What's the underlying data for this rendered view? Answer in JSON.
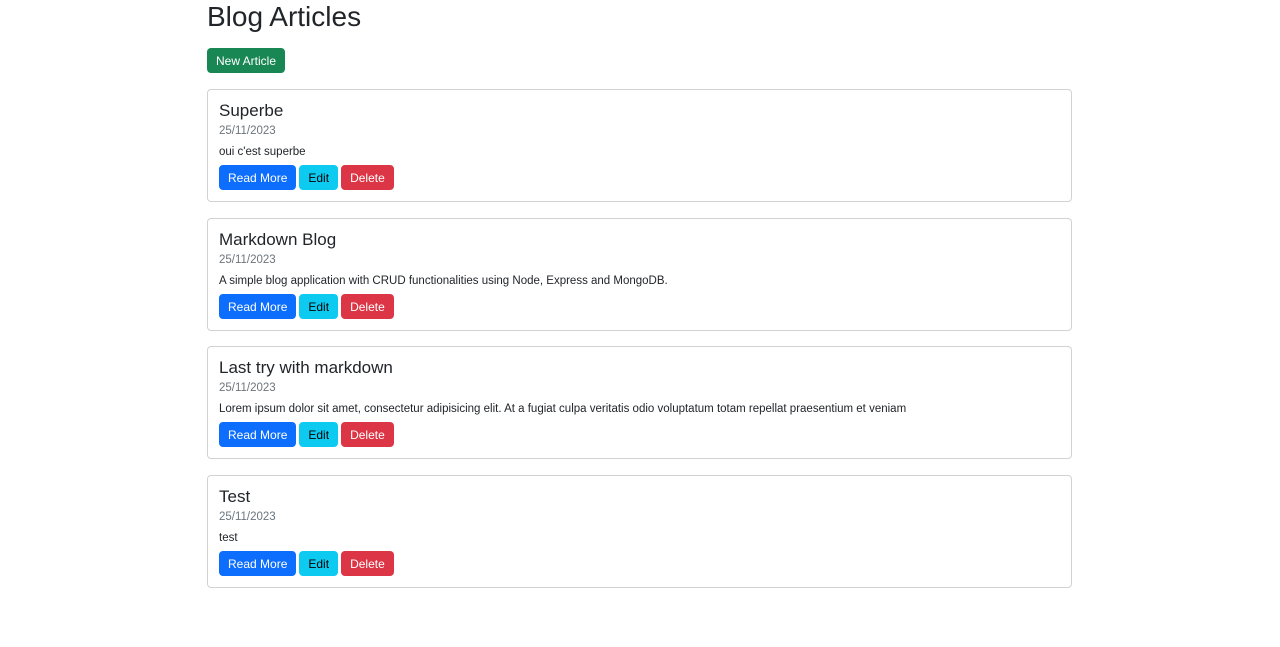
{
  "page": {
    "title": "Blog Articles"
  },
  "toolbar": {
    "new_article_label": "New Article"
  },
  "articles": [
    {
      "title": "Superbe",
      "date": "25/11/2023",
      "description": "oui c'est superbe"
    },
    {
      "title": "Markdown Blog",
      "date": "25/11/2023",
      "description": "A simple blog application with CRUD functionalities using Node, Express and MongoDB."
    },
    {
      "title": "Last try with markdown",
      "date": "25/11/2023",
      "description": "Lorem ipsum dolor sit amet, consectetur adipisicing elit. At a fugiat culpa veritatis odio voluptatum totam repellat praesentium et veniam"
    },
    {
      "title": "Test",
      "date": "25/11/2023",
      "description": "test"
    }
  ],
  "actions": {
    "read_more_label": "Read More",
    "edit_label": "Edit",
    "delete_label": "Delete"
  },
  "colors": {
    "success": "#198754",
    "primary": "#0d6efd",
    "info": "#0dcaf0",
    "danger": "#dc3545"
  }
}
